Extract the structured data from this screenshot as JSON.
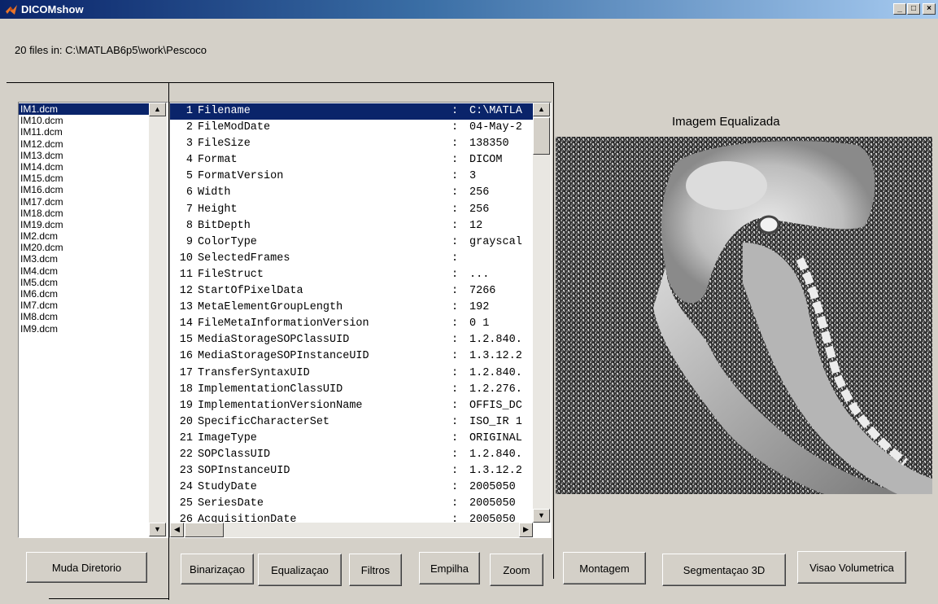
{
  "window": {
    "title": "DICOMshow",
    "buttons": {
      "minimize": "_",
      "maximize": "□",
      "close": "×"
    }
  },
  "files_info": "20 files in: C:\\MATLAB6p5\\work\\Pescoco",
  "file_list": {
    "selected_index": 0,
    "items": [
      "IM1.dcm",
      "IM10.dcm",
      "IM11.dcm",
      "IM12.dcm",
      "IM13.dcm",
      "IM14.dcm",
      "IM15.dcm",
      "IM16.dcm",
      "IM17.dcm",
      "IM18.dcm",
      "IM19.dcm",
      "IM2.dcm",
      "IM20.dcm",
      "IM3.dcm",
      "IM4.dcm",
      "IM5.dcm",
      "IM6.dcm",
      "IM7.dcm",
      "IM8.dcm",
      "IM9.dcm"
    ]
  },
  "info_list": {
    "selected_index": 0,
    "rows": [
      {
        "n": "1",
        "key": "Filename",
        "val": "C:\\MATLA"
      },
      {
        "n": "2",
        "key": "FileModDate",
        "val": "04-May-2"
      },
      {
        "n": "3",
        "key": "FileSize",
        "val": "138350"
      },
      {
        "n": "4",
        "key": "Format",
        "val": "DICOM"
      },
      {
        "n": "5",
        "key": "FormatVersion",
        "val": "3"
      },
      {
        "n": "6",
        "key": "Width",
        "val": "256"
      },
      {
        "n": "7",
        "key": "Height",
        "val": "256"
      },
      {
        "n": "8",
        "key": "BitDepth",
        "val": "12"
      },
      {
        "n": "9",
        "key": "ColorType",
        "val": "grayscal"
      },
      {
        "n": "10",
        "key": "SelectedFrames",
        "val": ""
      },
      {
        "n": "11",
        "key": "FileStruct",
        "val": "..."
      },
      {
        "n": "12",
        "key": "StartOfPixelData",
        "val": "7266"
      },
      {
        "n": "13",
        "key": "MetaElementGroupLength",
        "val": "192"
      },
      {
        "n": "14",
        "key": "FileMetaInformationVersion",
        "val": "0  1"
      },
      {
        "n": "15",
        "key": "MediaStorageSOPClassUID",
        "val": "1.2.840."
      },
      {
        "n": "16",
        "key": "MediaStorageSOPInstanceUID",
        "val": "1.3.12.2"
      },
      {
        "n": "17",
        "key": "TransferSyntaxUID",
        "val": "1.2.840."
      },
      {
        "n": "18",
        "key": "ImplementationClassUID",
        "val": "1.2.276."
      },
      {
        "n": "19",
        "key": "ImplementationVersionName",
        "val": "OFFIS_DC"
      },
      {
        "n": "20",
        "key": "SpecificCharacterSet",
        "val": "ISO_IR 1"
      },
      {
        "n": "21",
        "key": "ImageType",
        "val": "ORIGINAL"
      },
      {
        "n": "22",
        "key": "SOPClassUID",
        "val": "1.2.840."
      },
      {
        "n": "23",
        "key": "SOPInstanceUID",
        "val": "1.3.12.2"
      },
      {
        "n": "24",
        "key": "StudyDate",
        "val": "2005050"
      },
      {
        "n": "25",
        "key": "SeriesDate",
        "val": "2005050"
      },
      {
        "n": "26",
        "key": "AcquisitionDate",
        "val": "2005050"
      }
    ]
  },
  "image_panel": {
    "title": "Imagem Equalizada"
  },
  "buttons": {
    "muda_diretorio": "Muda Diretorio",
    "binarizacao": "Binarizaçao",
    "equalizacao": "Equalizaçao",
    "filtros": "Filtros",
    "empilha": "Empilha",
    "zoom": "Zoom",
    "montagem": "Montagem",
    "segmentacao3d": "Segmentaçao 3D",
    "visao_volumetrica": "Visao Volumetrica"
  },
  "icons": {
    "app": "matlab-logo-icon",
    "scroll_up": "arrow-up-icon",
    "scroll_down": "arrow-down-icon",
    "scroll_left": "arrow-left-icon",
    "scroll_right": "arrow-right-icon"
  }
}
